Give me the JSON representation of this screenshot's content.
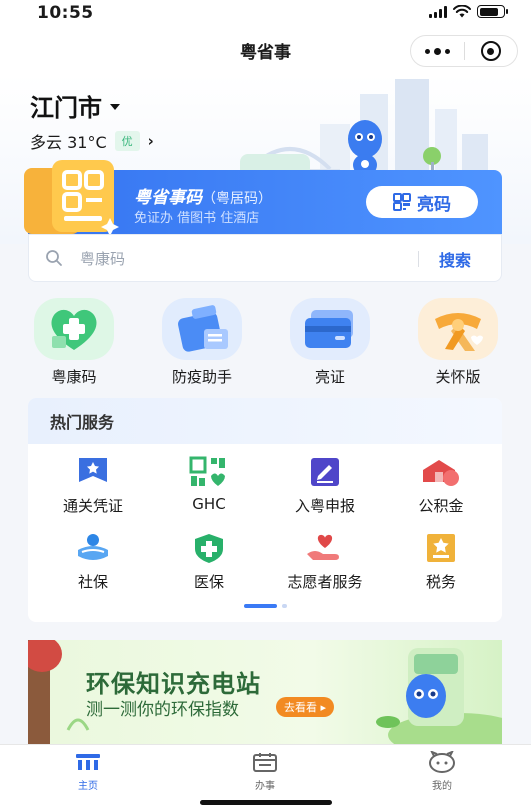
{
  "status_bar": {
    "time": "10:55"
  },
  "nav": {
    "title": "粤省事",
    "more_icon": "more-dots-icon",
    "close_icon": "target-close-icon"
  },
  "location": {
    "city": "江门市",
    "weather": "多云 31°C",
    "aqi": "优"
  },
  "code_card": {
    "title": "粤省事码",
    "title_note": "（粤居码）",
    "subtitle": "免证办 借图书 住酒店",
    "button": "亮码"
  },
  "search": {
    "placeholder": "粤康码",
    "button": "搜索"
  },
  "quick_entries": [
    {
      "label": "粤康码",
      "icon": "health-heart-icon"
    },
    {
      "label": "防疫助手",
      "icon": "epidemic-assistant-icon"
    },
    {
      "label": "亮证",
      "icon": "cards-icon"
    },
    {
      "label": "关怀版",
      "icon": "care-scarf-icon"
    }
  ],
  "hot_services": {
    "title": "热门服务",
    "items": [
      {
        "label": "通关凭证",
        "icon": "customs-pass-icon",
        "color": "#3a6fe0"
      },
      {
        "label": "GHC",
        "icon": "ghc-icon",
        "color": "#34b56c"
      },
      {
        "label": "入粤申报",
        "icon": "declare-icon",
        "color": "#4f46c9"
      },
      {
        "label": "公积金",
        "icon": "housing-fund-icon",
        "color": "#e24a4a"
      },
      {
        "label": "社保",
        "icon": "social-security-icon",
        "color": "#2d86e6"
      },
      {
        "label": "医保",
        "icon": "medical-insurance-icon",
        "color": "#28b06a"
      },
      {
        "label": "志愿者服务",
        "icon": "volunteer-icon",
        "color": "#e04848"
      },
      {
        "label": "税务",
        "icon": "tax-icon",
        "color": "#f0b23a"
      }
    ]
  },
  "banner": {
    "title": "环保知识充电站",
    "subtitle": "测一测你的环保指数",
    "cta": "去看看"
  },
  "tab_bar": [
    {
      "label": "主页",
      "icon": "home-icon",
      "active": true
    },
    {
      "label": "办事",
      "icon": "calendar-icon",
      "active": false
    },
    {
      "label": "我的",
      "icon": "profile-icon",
      "active": false
    }
  ],
  "colors": {
    "primary": "#2f6ae6",
    "card_blue": "#3574f0",
    "aqi_green": "#3bb77e"
  }
}
